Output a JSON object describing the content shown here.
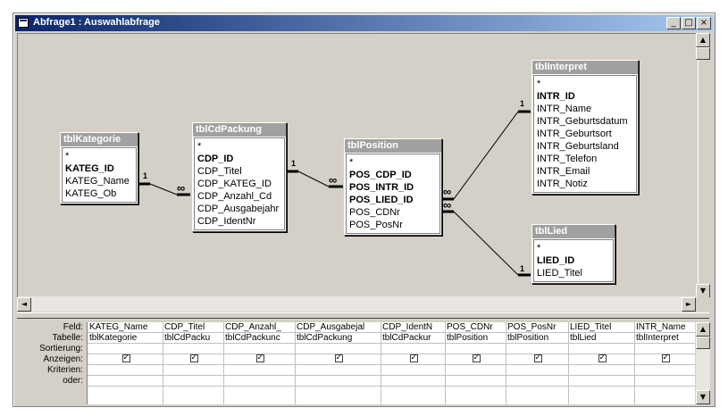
{
  "window": {
    "title": "Abfrage1 : Auswahlabfrage",
    "buttons": {
      "minimize": "_",
      "maximize": "□",
      "close": "×"
    }
  },
  "tables": [
    {
      "name": "tblKategorie",
      "fields": [
        {
          "label": "*",
          "key": false
        },
        {
          "label": "KATEG_ID",
          "key": true
        },
        {
          "label": "KATEG_Name",
          "key": false
        },
        {
          "label": "KATEG_Ob",
          "key": false
        }
      ]
    },
    {
      "name": "tblCdPackung",
      "fields": [
        {
          "label": "*",
          "key": false
        },
        {
          "label": "CDP_ID",
          "key": true
        },
        {
          "label": "CDP_Titel",
          "key": false
        },
        {
          "label": "CDP_KATEG_ID",
          "key": false
        },
        {
          "label": "CDP_Anzahl_Cd",
          "key": false
        },
        {
          "label": "CDP_Ausgabejahr",
          "key": false
        },
        {
          "label": "CDP_IdentNr",
          "key": false
        }
      ]
    },
    {
      "name": "tblPosition",
      "fields": [
        {
          "label": "*",
          "key": false
        },
        {
          "label": "POS_CDP_ID",
          "key": true
        },
        {
          "label": "POS_INTR_ID",
          "key": true
        },
        {
          "label": "POS_LIED_ID",
          "key": true
        },
        {
          "label": "POS_CDNr",
          "key": false
        },
        {
          "label": "POS_PosNr",
          "key": false
        }
      ]
    },
    {
      "name": "tblInterpret",
      "fields": [
        {
          "label": "*",
          "key": false
        },
        {
          "label": "INTR_ID",
          "key": true
        },
        {
          "label": "INTR_Name",
          "key": false
        },
        {
          "label": "INTR_Geburtsdatum",
          "key": false
        },
        {
          "label": "INTR_Geburtsort",
          "key": false
        },
        {
          "label": "INTR_Geburtsland",
          "key": false
        },
        {
          "label": "INTR_Telefon",
          "key": false
        },
        {
          "label": "INTR_Email",
          "key": false
        },
        {
          "label": "INTR_Notiz",
          "key": false
        }
      ]
    },
    {
      "name": "tblLied",
      "fields": [
        {
          "label": "*",
          "key": false
        },
        {
          "label": "LIED_ID",
          "key": true
        },
        {
          "label": "LIED_Titel",
          "key": false
        }
      ]
    }
  ],
  "relationships": {
    "one_label": "1",
    "many_label": "∞"
  },
  "grid": {
    "row_labels": [
      "Feld:",
      "Tabelle:",
      "Sortierung:",
      "Anzeigen:",
      "Kriterien:",
      "oder:"
    ],
    "columns": [
      {
        "feld": "KATEG_Name",
        "tabelle": "tblKategorie",
        "anzeigen": true
      },
      {
        "feld": "CDP_Titel",
        "tabelle": "tblCdPacku",
        "anzeigen": true
      },
      {
        "feld": "CDP_Anzahl_",
        "tabelle": "tblCdPackunc",
        "anzeigen": true
      },
      {
        "feld": "CDP_Ausgabejal",
        "tabelle": "tblCdPackung",
        "anzeigen": true
      },
      {
        "feld": "CDP_IdentN",
        "tabelle": "tblCdPackur",
        "anzeigen": true
      },
      {
        "feld": "POS_CDNr",
        "tabelle": "tblPosition",
        "anzeigen": true
      },
      {
        "feld": "POS_PosNr",
        "tabelle": "tblPosition",
        "anzeigen": true
      },
      {
        "feld": "LIED_Titel",
        "tabelle": "tblLied",
        "anzeigen": true
      },
      {
        "feld": "INTR_Name",
        "tabelle": "tblInterpret",
        "anzeigen": true
      }
    ]
  },
  "scroll_icons": {
    "up": "▲",
    "down": "▼",
    "left": "◄",
    "right": "►"
  }
}
